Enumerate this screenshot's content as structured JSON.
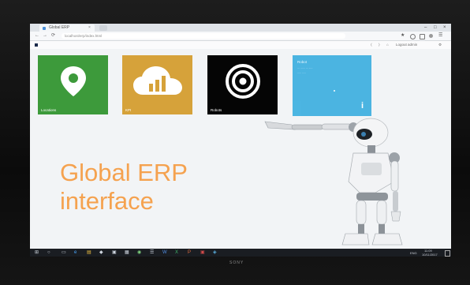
{
  "browser": {
    "tab_title": "Global ERP",
    "tab_close": "×",
    "window_controls": [
      "–",
      "□",
      "×"
    ],
    "nav": [
      "←",
      "→",
      "⟳"
    ],
    "url": "localhost/erp/index.html",
    "toolbar_icons": [
      "★",
      "☰"
    ]
  },
  "appbar": {
    "items": [
      "⟨",
      "⟩",
      "⌂",
      "Logout admin",
      "⚙"
    ]
  },
  "tiles": [
    {
      "label": "Locations",
      "color": "#3d9a3b",
      "icon": "map-pin-icon"
    },
    {
      "label": "KPI",
      "color": "#d6a23a",
      "icon": "cloud-chart-icon"
    },
    {
      "label": "Robots",
      "color": "#050505",
      "icon": "target-icon"
    }
  ],
  "info_tile": {
    "title": "Robot",
    "lines": [
      "... ...... ... .....",
      "..... ....."
    ],
    "glyph": "i",
    "color": "#3fb0e0"
  },
  "headline": {
    "line1": "Global ERP",
    "line2": "interface",
    "color": "#f5a24f"
  },
  "taskbar": {
    "start": "⊞",
    "search": "○",
    "apps": [
      "▭",
      "e",
      "▤",
      "◆",
      "▣",
      "▦",
      "◉",
      "☰",
      "W",
      "X",
      "P",
      "▣",
      "◈"
    ],
    "tray_time": "11:09",
    "tray_date": "10/11/2017",
    "tray_lang": "ENG"
  },
  "monitor_brand": "SONY"
}
